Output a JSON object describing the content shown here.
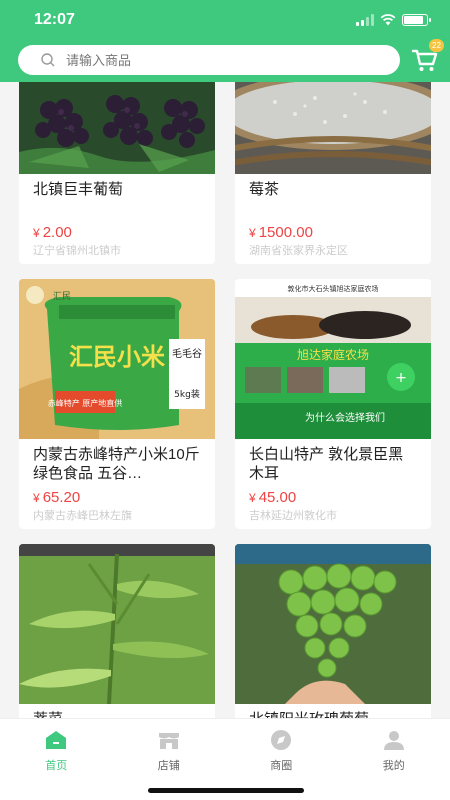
{
  "status_bar": {
    "time": "12:07",
    "battery_level": 0.85
  },
  "search": {
    "placeholder": "请输入商品"
  },
  "cart": {
    "badge": "22",
    "icon": "cart-icon"
  },
  "products": [
    {
      "title": "北镇巨丰葡萄",
      "price": "2.00",
      "currency": "¥",
      "location": "辽宁省锦州北镇市"
    },
    {
      "title": "莓茶",
      "price": "1500.00",
      "currency": "¥",
      "location": "湖南省张家界永定区"
    },
    {
      "title": "内蒙古赤峰特产小米10斤绿色食品 五谷…",
      "price": "65.20",
      "currency": "¥",
      "location": "内蒙古赤峰巴林左旗",
      "image_text": {
        "brand": "汇民",
        "name": "汇民小米",
        "tag": "毛毛谷",
        "weight": "5kg装",
        "banner": "赤峰特产 原产地直供"
      }
    },
    {
      "title": "长白山特产 敦化景臣黑木耳",
      "price": "45.00",
      "currency": "¥",
      "location": "吉林延边州敦化市",
      "image_text": {
        "top": "敦化市大石头镇旭达家庭农场",
        "farm": "旭达家庭农场",
        "slogan": "为什么会选择我们"
      }
    },
    {
      "title": "荠菜",
      "price": "",
      "currency": "",
      "location": ""
    },
    {
      "title": "北镇阳光玫瑰葡萄",
      "price": "",
      "currency": "",
      "location": ""
    }
  ],
  "bottom_nav": [
    {
      "label": "首页",
      "icon": "home-icon",
      "active": true
    },
    {
      "label": "店铺",
      "icon": "store-icon",
      "active": false
    },
    {
      "label": "商圈",
      "icon": "circle-icon",
      "active": false
    },
    {
      "label": "我的",
      "icon": "user-icon",
      "active": false
    }
  ],
  "colors": {
    "brand": "#3ec97f",
    "price": "#e44444",
    "accent_badge": "#f5c542"
  }
}
